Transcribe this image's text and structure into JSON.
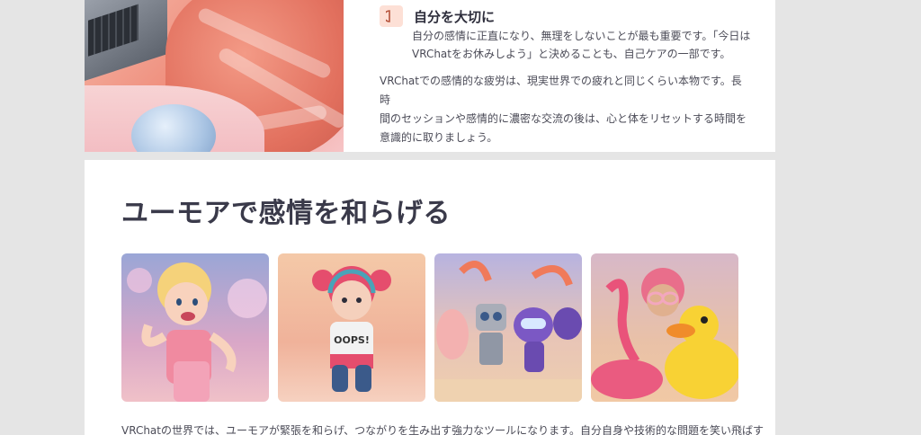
{
  "tip": {
    "icon": "half-circle-icon",
    "title": "自分を大切に",
    "body_line1": "自分の感情に正直になり、無理をしないことが最も重要です。「今日は",
    "body_line2": "VRChatをお休みしよう」と決めることも、自己ケアの一部です。"
  },
  "paragraph": {
    "line1": "VRChatでの感情的な疲労は、現実世界での疲れと同じくらい本物です。長時",
    "line2": "間のセッションや感情的に濃密な交流の後は、心と体をリセットする時間を",
    "line3": "意識的に取りましょう。"
  },
  "section": {
    "heading": "ユーモアで感情を和らげる"
  },
  "gallery": [
    {
      "name": "avatar-girl-blonde-pink"
    },
    {
      "name": "avatar-girl-oops-shirt"
    },
    {
      "name": "avatar-robots-group"
    },
    {
      "name": "avatar-girl-flamingo-duck"
    }
  ],
  "footer": {
    "text": "VRChatの世界では、ユーモアが緊張を和らげ、つながりを生み出す強力なツールになります。自分自身や技術的な問題を笑い飛ばす"
  },
  "colors": {
    "background": "#e5e5e5",
    "card": "#ffffff",
    "icon_bg": "#fde0d6",
    "icon_fg": "#b5523a",
    "heading": "#3a3a4a"
  }
}
